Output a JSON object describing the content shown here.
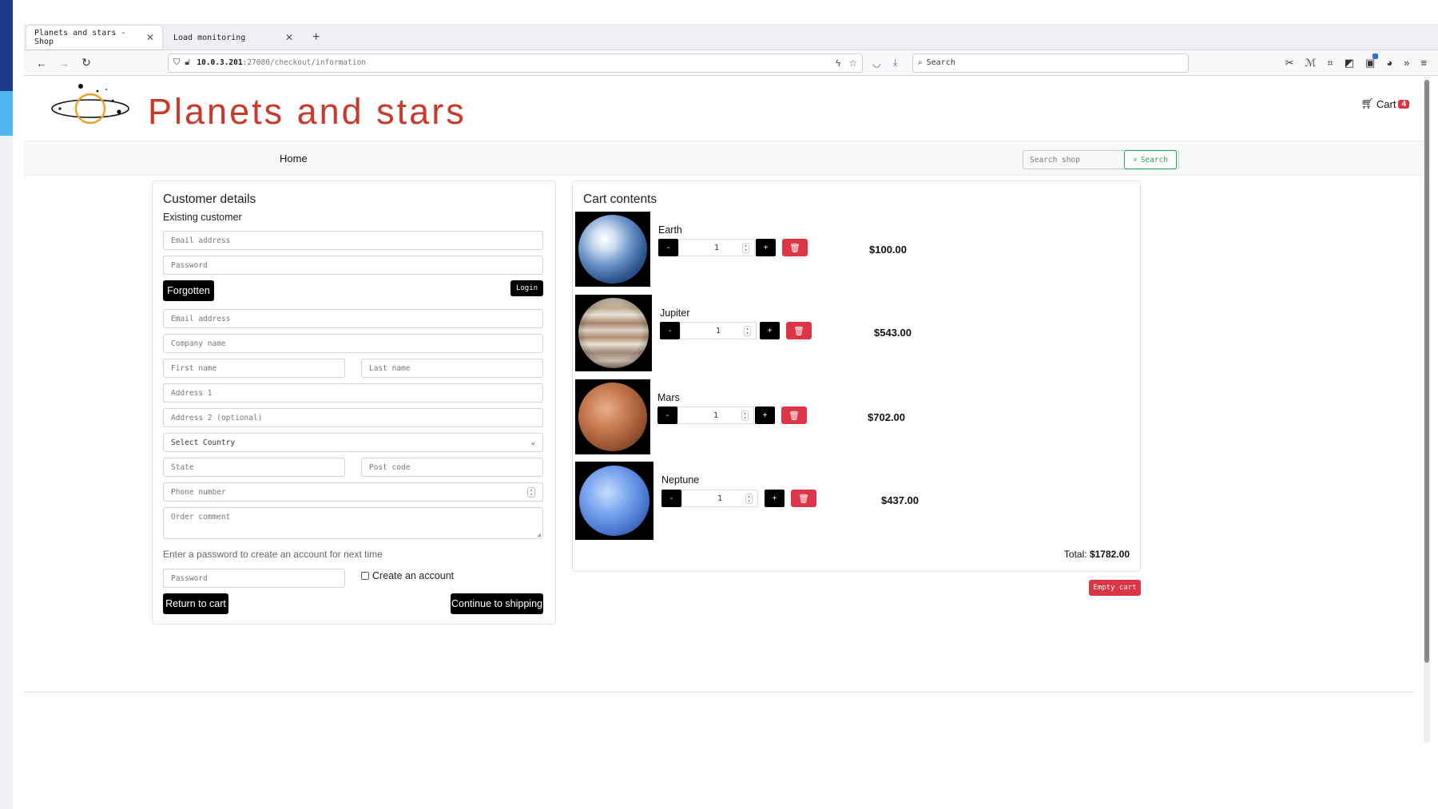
{
  "browser": {
    "tabs": [
      {
        "label": "Planets and stars - Shop",
        "active": true
      },
      {
        "label": "Load monitoring",
        "active": false
      }
    ],
    "url_host": "10.0.3.201",
    "url_path": ":27080/checkout/information",
    "search_placeholder": "Search"
  },
  "site": {
    "title": "Planets and stars",
    "cart_label": "Cart",
    "cart_count": "4",
    "nav_home": "Home",
    "search_placeholder": "Search shop",
    "search_button": "Search"
  },
  "customer": {
    "title": "Customer details",
    "existing_label": "Existing customer",
    "login_email_placeholder": "Email address",
    "login_password_placeholder": "Password",
    "forgotten_label": "Forgotten",
    "login_label": "Login",
    "email_placeholder": "Email address",
    "company_placeholder": "Company name",
    "first_name_placeholder": "First name",
    "last_name_placeholder": "Last name",
    "address1_placeholder": "Address 1",
    "address2_placeholder": "Address 2 (optional)",
    "country_selected": "Select Country",
    "state_placeholder": "State",
    "postcode_placeholder": "Post code",
    "phone_placeholder": "Phone number",
    "comment_placeholder": "Order comment",
    "account_hint": "Enter a password to create an account for next time",
    "account_password_placeholder": "Password",
    "create_account_label": "Create an account",
    "return_label": "Return to cart",
    "continue_label": "Continue to shipping"
  },
  "cart": {
    "title": "Cart contents",
    "items": [
      {
        "name": "Earth",
        "qty": "1",
        "price": "$100.00",
        "minus": "-",
        "plus": "+"
      },
      {
        "name": "Jupiter",
        "qty": "1",
        "price": "$543.00",
        "minus": "-",
        "plus": "+"
      },
      {
        "name": "Mars",
        "qty": "1",
        "price": "$702.00",
        "minus": "-",
        "plus": "+"
      },
      {
        "name": "Neptune",
        "qty": "1",
        "price": "$437.00",
        "minus": "-",
        "plus": "+"
      }
    ],
    "total_label": "Total:",
    "total_value": "$1782.00",
    "empty_label": "Empty cart"
  },
  "colors": {
    "brand_red": "#c93a2c",
    "danger": "#dc3545",
    "success": "#28a745"
  }
}
